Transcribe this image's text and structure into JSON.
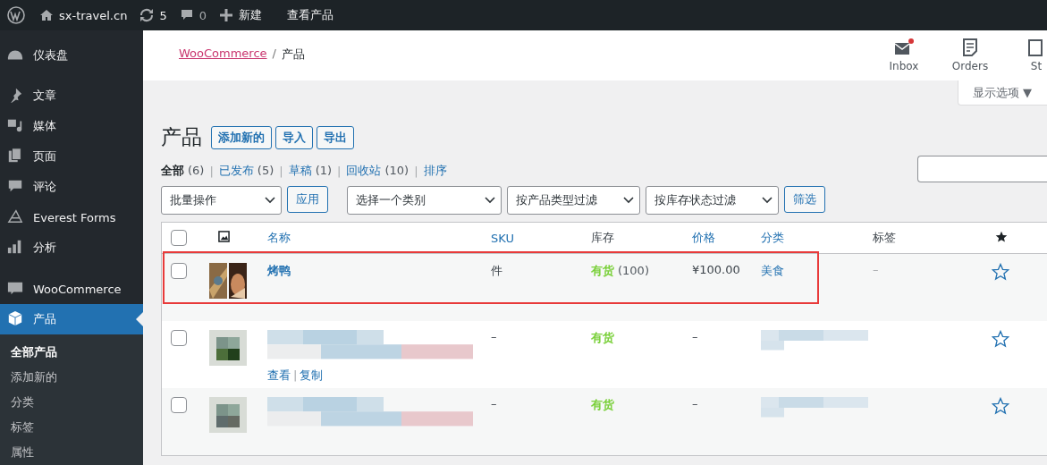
{
  "admin_bar": {
    "site": "sx-travel.cn",
    "updates": "5",
    "comments": "0",
    "new": "新建",
    "view": "查看产品"
  },
  "sidebar": {
    "items": [
      {
        "label": "仪表盘",
        "selected": false
      },
      {
        "label": "文章",
        "selected": false
      },
      {
        "label": "媒体",
        "selected": false
      },
      {
        "label": "页面",
        "selected": false
      },
      {
        "label": "评论",
        "selected": false
      },
      {
        "label": "Everest Forms",
        "selected": false
      },
      {
        "label": "分析",
        "selected": false
      },
      {
        "label": "WooCommerce",
        "selected": false
      },
      {
        "label": "产品",
        "selected": true
      }
    ],
    "submenu": [
      {
        "label": "全部产品",
        "selected": true
      },
      {
        "label": "添加新的",
        "selected": false
      },
      {
        "label": "分类",
        "selected": false
      },
      {
        "label": "标签",
        "selected": false
      },
      {
        "label": "属性",
        "selected": false
      }
    ]
  },
  "header": {
    "breadcrumb_link": "WooCommerce",
    "breadcrumb_sep": "/",
    "breadcrumb_current": "产品",
    "actions": [
      {
        "label": "Inbox"
      },
      {
        "label": "Orders"
      },
      {
        "label": "St"
      }
    ]
  },
  "screen_options": "显示选项 ▼",
  "page": {
    "title": "产品",
    "buttons": [
      "添加新的",
      "导入",
      "导出"
    ]
  },
  "status_filters": [
    {
      "label": "全部",
      "count": "(6)",
      "selected": true
    },
    {
      "separator": "|",
      "label": "已发布",
      "count": "(5)",
      "selected": false
    },
    {
      "separator": "|",
      "label": "草稿",
      "count": "(1)",
      "selected": false
    },
    {
      "separator": "|",
      "label": "回收站",
      "count": "(10)",
      "selected": false
    },
    {
      "separator": "|",
      "label": "排序",
      "selected": false
    }
  ],
  "toolbar": {
    "bulk": "批量操作",
    "apply": "应用",
    "filters": [
      "选择一个类别",
      "按产品类型过滤",
      "按库存状态过滤"
    ],
    "filter_button": "筛选"
  },
  "table": {
    "select_all_checked": false,
    "columns": [
      "名称",
      "SKU",
      "库存",
      "价格",
      "分类",
      "标签"
    ],
    "rows": [
      {
        "name": "烤鸭",
        "sku": "件",
        "stock": "有货",
        "stock_count": "(100)",
        "price": "¥100.00",
        "category": "美食",
        "tags": "–",
        "featured": false,
        "highlighted": true,
        "checked": false
      },
      {
        "sku": "–",
        "stock": "有货",
        "price": "–",
        "actions": [
          "查看",
          "复制"
        ],
        "actions_separator": "|",
        "featured": false,
        "highlighted": false,
        "checked": false
      },
      {
        "sku": "–",
        "stock": "有货",
        "price": "–",
        "featured": false,
        "highlighted": false,
        "checked": false
      }
    ]
  }
}
